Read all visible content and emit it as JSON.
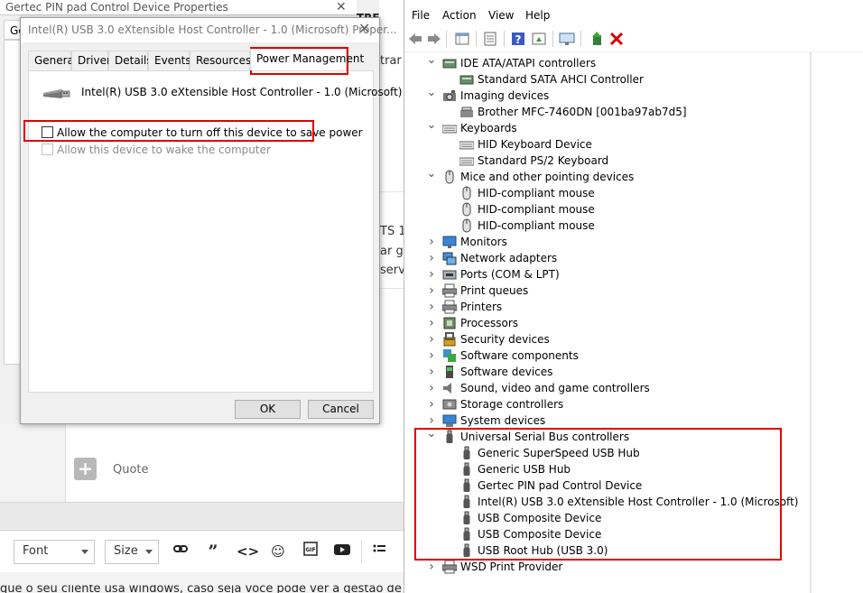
{
  "background": {
    "window_title": "Gertec PIN pad Control Device Properties",
    "tab_fragment": "Ge",
    "page_fragments": [
      "TRE",
      "trar",
      "TS 1",
      "ar g",
      "serv"
    ],
    "quote_label": "Quote",
    "editor_toolbar": {
      "font_label": "Font",
      "size_label": "Size"
    },
    "bottom_text": "que o seu cliente usa windows, caso seja você pode ver a gestão de energ"
  },
  "dialog": {
    "title": "Intel(R) USB 3.0 eXtensible Host Controller - 1.0 (Microsoft) Proper...",
    "tabs": [
      "General",
      "Driver",
      "Details",
      "Events",
      "Resources",
      "Power Management"
    ],
    "active_tab": "Power Management",
    "device_name": "Intel(R) USB 3.0 eXtensible Host Controller - 1.0 (Microsoft)",
    "options": [
      {
        "label": "Allow the computer to turn off this device to save power",
        "checked": false,
        "enabled": true
      },
      {
        "label": "Allow this device to wake the computer",
        "checked": false,
        "enabled": false
      }
    ],
    "ok_label": "OK",
    "cancel_label": "Cancel"
  },
  "device_manager": {
    "menu": [
      "File",
      "Action",
      "View",
      "Help"
    ],
    "tree": [
      {
        "label": "IDE ATA/ATAPI controllers",
        "icon": "ide-controller-icon",
        "expanded": true,
        "children": [
          "Standard SATA AHCI Controller"
        ]
      },
      {
        "label": "Imaging devices",
        "icon": "camera-icon",
        "expanded": true,
        "children": [
          "Brother MFC-7460DN [001ba97ab7d5]"
        ]
      },
      {
        "label": "Keyboards",
        "icon": "keyboard-icon",
        "expanded": true,
        "children": [
          "HID Keyboard Device",
          "Standard PS/2 Keyboard"
        ]
      },
      {
        "label": "Mice and other pointing devices",
        "icon": "mouse-icon",
        "expanded": true,
        "children": [
          "HID-compliant mouse",
          "HID-compliant mouse",
          "HID-compliant mouse"
        ]
      },
      {
        "label": "Monitors",
        "icon": "monitor-icon",
        "expanded": false,
        "children": []
      },
      {
        "label": "Network adapters",
        "icon": "network-icon",
        "expanded": false,
        "children": []
      },
      {
        "label": "Ports (COM & LPT)",
        "icon": "port-icon",
        "expanded": false,
        "children": []
      },
      {
        "label": "Print queues",
        "icon": "printer-icon",
        "expanded": false,
        "children": []
      },
      {
        "label": "Printers",
        "icon": "printer-icon",
        "expanded": false,
        "children": []
      },
      {
        "label": "Processors",
        "icon": "cpu-icon",
        "expanded": false,
        "children": []
      },
      {
        "label": "Security devices",
        "icon": "security-icon",
        "expanded": false,
        "children": []
      },
      {
        "label": "Software components",
        "icon": "software-component-icon",
        "expanded": false,
        "children": []
      },
      {
        "label": "Software devices",
        "icon": "software-device-icon",
        "expanded": false,
        "children": []
      },
      {
        "label": "Sound, video and game controllers",
        "icon": "speaker-icon",
        "expanded": false,
        "children": []
      },
      {
        "label": "Storage controllers",
        "icon": "storage-icon",
        "expanded": false,
        "children": []
      },
      {
        "label": "System devices",
        "icon": "system-icon",
        "expanded": false,
        "children": []
      },
      {
        "label": "Universal Serial Bus controllers",
        "icon": "usb-icon",
        "expanded": true,
        "children": [
          "Generic SuperSpeed USB Hub",
          "Generic USB Hub",
          "Gertec PIN pad Control Device",
          "Intel(R) USB 3.0 eXtensible Host Controller - 1.0 (Microsoft)",
          "USB Composite Device",
          "USB Composite Device",
          "USB Root Hub (USB 3.0)"
        ]
      },
      {
        "label": "WSD Print Provider",
        "icon": "printer-icon",
        "expanded": false,
        "children": []
      }
    ]
  },
  "colors": {
    "highlight": "#e00000",
    "dialog_bg": "#f0f0f0",
    "window_bg": "#ffffff"
  }
}
